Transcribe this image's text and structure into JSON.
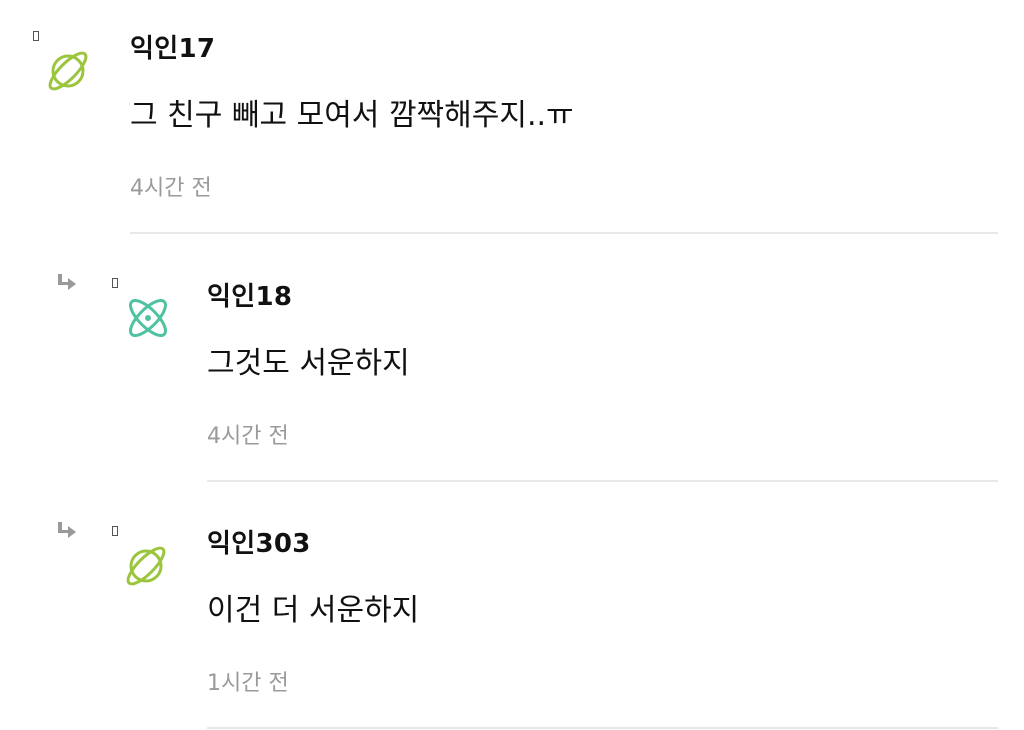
{
  "comments": [
    {
      "author": "익인17",
      "text": "그 친구 빼고 모여서 깜짝해주지..ㅠ",
      "time": "4시간 전",
      "avatar_icon": "planet-icon",
      "avatar_color": "#9bc53d",
      "is_reply": false
    },
    {
      "author": "익인18",
      "text": "그것도 서운하지",
      "time": "4시간 전",
      "avatar_icon": "atom-icon",
      "avatar_color": "#4fc3a1",
      "is_reply": true
    },
    {
      "author": "익인303",
      "text": "이건 더 서운하지",
      "time": "1시간 전",
      "avatar_icon": "planet-icon",
      "avatar_color": "#9bc53d",
      "is_reply": true
    }
  ]
}
